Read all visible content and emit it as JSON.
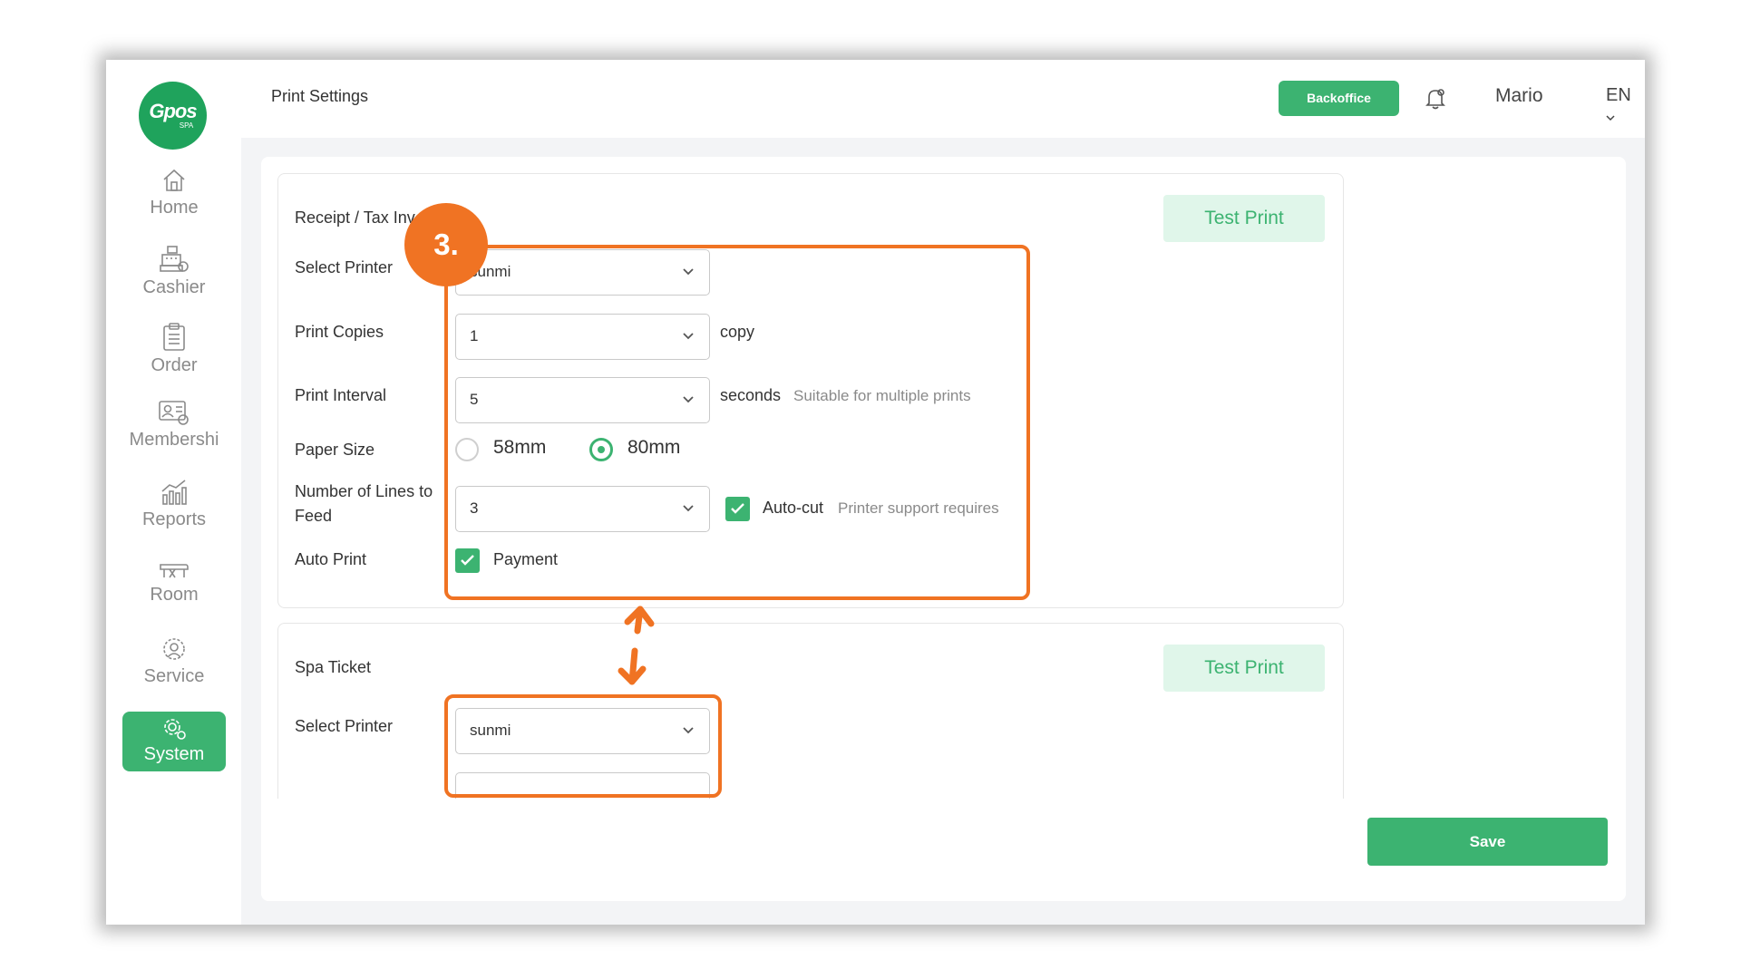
{
  "app": {
    "logo_main": "Gpos",
    "logo_sub": "SPA"
  },
  "sidebar": {
    "items": [
      {
        "label": "Home",
        "icon": "home-icon"
      },
      {
        "label": "Cashier",
        "icon": "cash-register-icon"
      },
      {
        "label": "Order",
        "icon": "clipboard-icon"
      },
      {
        "label": "Membershi",
        "icon": "member-card-icon"
      },
      {
        "label": "Reports",
        "icon": "chart-icon"
      },
      {
        "label": "Room",
        "icon": "massage-bed-icon"
      },
      {
        "label": "Service",
        "icon": "service-icon"
      },
      {
        "label": "System",
        "icon": "gear-icon",
        "active": true
      }
    ]
  },
  "header": {
    "title": "Print Settings",
    "backoffice_label": "Backoffice",
    "user": "Mario",
    "language": "EN"
  },
  "receipt": {
    "title": "Receipt / Tax Inv",
    "test_print": "Test Print",
    "select_printer_label": "Select Printer",
    "select_printer_value": "sunmi",
    "print_copies_label": "Print Copies",
    "print_copies_value": "1",
    "print_copies_suffix": "copy",
    "print_interval_label": "Print Interval",
    "print_interval_value": "5",
    "print_interval_suffix": "seconds",
    "print_interval_hint": "Suitable for multiple prints",
    "paper_size_label": "Paper Size",
    "paper_options": [
      "58mm",
      "80mm"
    ],
    "paper_selected": "80mm",
    "feed_lines_label_1": "Number of Lines to",
    "feed_lines_label_2": "Feed",
    "feed_lines_value": "3",
    "autocut_label": "Auto-cut",
    "autocut_checked": true,
    "autocut_hint": "Printer support requires",
    "auto_print_label": "Auto Print",
    "auto_print_option": "Payment",
    "auto_print_checked": true
  },
  "spa_ticket": {
    "title": "Spa Ticket",
    "test_print": "Test Print",
    "select_printer_label": "Select Printer",
    "select_printer_value": "sunmi"
  },
  "save_label": "Save",
  "annotation": {
    "step": "3.",
    "color": "#f07323"
  },
  "colors": {
    "accent": "#3cb371",
    "accent_light": "#e0f6ea"
  }
}
